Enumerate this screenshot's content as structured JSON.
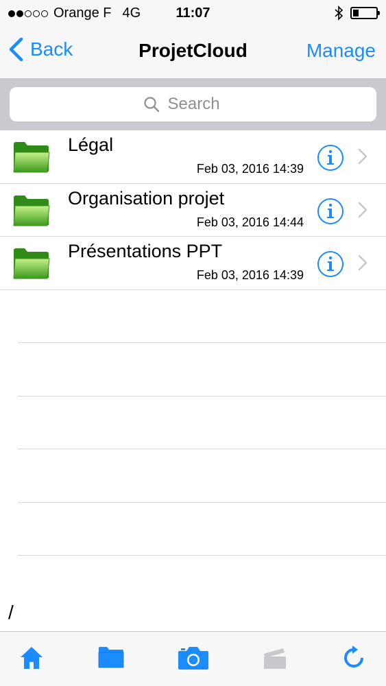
{
  "status_bar": {
    "carrier": "Orange F",
    "network": "4G",
    "time": "11:07",
    "battery_level": 0.25
  },
  "nav": {
    "back_label": "Back",
    "title": "ProjetCloud",
    "manage_label": "Manage"
  },
  "search": {
    "placeholder": "Search"
  },
  "folders": [
    {
      "name": "Légal",
      "date": "Feb 03, 2016 14:39"
    },
    {
      "name": "Organisation projet",
      "date": "Feb 03, 2016 14:44"
    },
    {
      "name": "Présentations PPT",
      "date": "Feb 03, 2016 14:39"
    }
  ],
  "path": "/",
  "tabs": [
    {
      "icon": "home-icon"
    },
    {
      "icon": "folder-icon"
    },
    {
      "icon": "camera-icon"
    },
    {
      "icon": "clapperboard-icon"
    },
    {
      "icon": "refresh-icon"
    }
  ],
  "colors": {
    "accent": "#1a8cff",
    "folder_green": "#5cb82e",
    "disabled": "#c7c7cc"
  }
}
